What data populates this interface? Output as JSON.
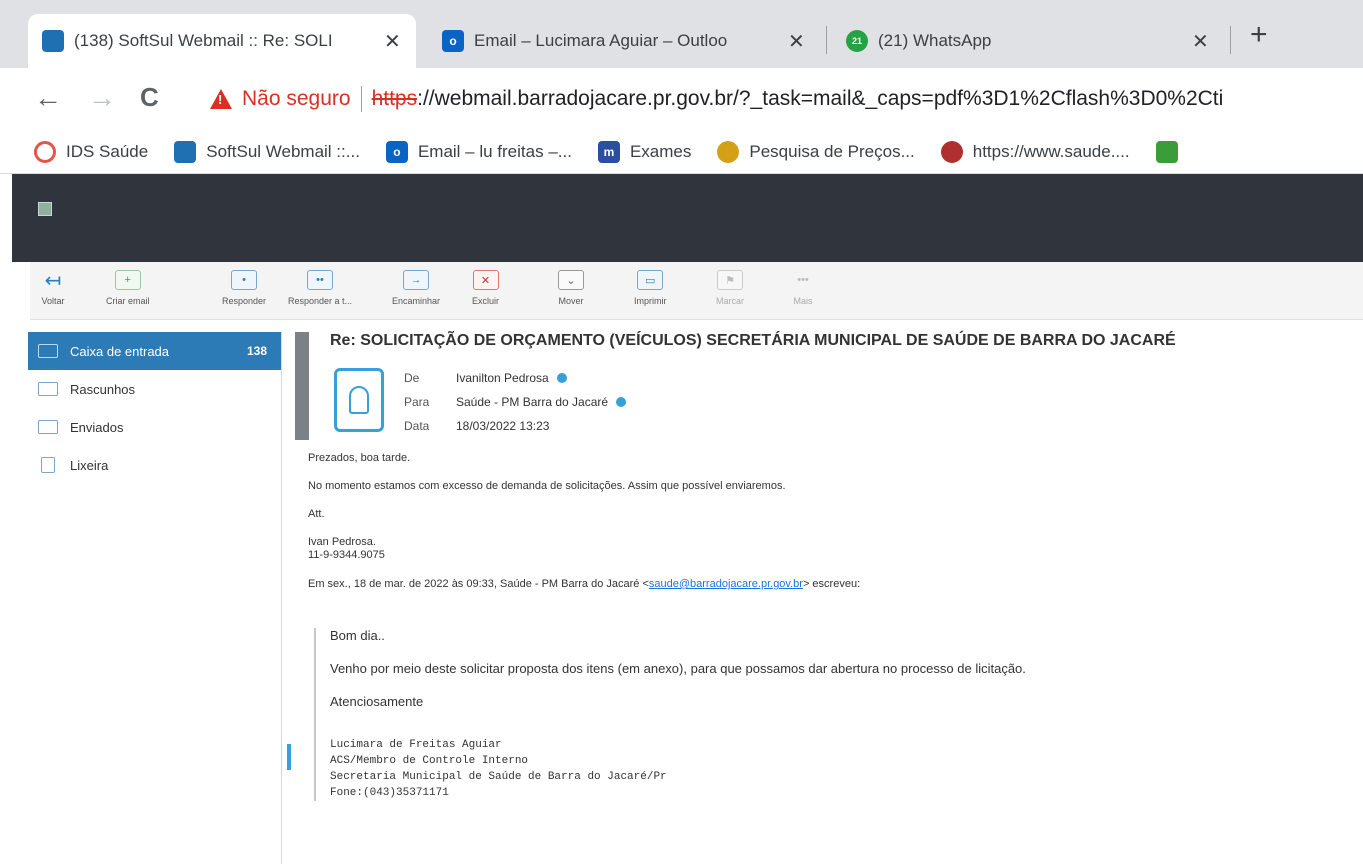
{
  "browser": {
    "tabs": [
      {
        "title": "(138) SoftSul Webmail :: Re: SOLI",
        "favicon": "webmail-favicon",
        "color": "#1f6fb3",
        "active": true
      },
      {
        "title": "Email – Lucimara Aguiar – Outloo",
        "favicon": "outlook-favicon",
        "color": "#0a64c4",
        "active": false
      },
      {
        "title": "(21) WhatsApp",
        "favicon": "whatsapp-favicon",
        "color": "#25a244",
        "badge": "21",
        "active": false
      }
    ],
    "close_glyph": "✕",
    "newtab_glyph": "+",
    "nav": {
      "back": "←",
      "forward": "→",
      "reload": "C"
    },
    "security_label": "Não seguro",
    "url_scheme": "https",
    "url_rest": "://webmail.barradojacare.pr.gov.br/?_task=mail&_caps=pdf%3D1%2Cflash%3D0%2Cti",
    "bookmarks": [
      {
        "label": "IDS Saúde",
        "icon": "ids-favicon",
        "color": "#e2574c"
      },
      {
        "label": "SoftSul Webmail ::...",
        "icon": "webmail-favicon",
        "color": "#1f6fb3"
      },
      {
        "label": "Email – lu freitas –...",
        "icon": "outlook-favicon",
        "color": "#0a64c4"
      },
      {
        "label": "Exames",
        "icon": "exames-favicon",
        "color": "#2a4fa0",
        "glyph": "m"
      },
      {
        "label": "Pesquisa de Preços...",
        "icon": "pesquisa-favicon",
        "color": "#d4a017"
      },
      {
        "label": "https://www.saude....",
        "icon": "saude-favicon",
        "color": "#b03030"
      }
    ]
  },
  "toolbar": {
    "voltar": "Voltar",
    "criar_email": "Criar email",
    "responder": "Responder",
    "responder_todos": "Responder a t...",
    "encaminhar": "Encaminhar",
    "excluir": "Excluir",
    "mover": "Mover",
    "imprimir": "Imprimir",
    "marcar": "Marcar",
    "mais": "Mais"
  },
  "folders": [
    {
      "label": "Caixa de entrada",
      "count": "138",
      "icon": "inbox-icon",
      "selected": true
    },
    {
      "label": "Rascunhos",
      "icon": "drafts-icon"
    },
    {
      "label": "Enviados",
      "icon": "sent-icon"
    },
    {
      "label": "Lixeira",
      "icon": "trash-icon"
    }
  ],
  "message": {
    "subject": "Re: SOLICITAÇÃO DE ORÇAMENTO (VEÍCULOS) SECRETÁRIA MUNICIPAL DE SAÚDE DE BARRA DO JACARÉ",
    "from_label": "De",
    "from": "Ivanilton Pedrosa",
    "to_label": "Para",
    "to": "Saúde - PM Barra do Jacaré",
    "date_label": "Data",
    "date": "18/03/2022 13:23",
    "body": {
      "greeting": "Prezados, boa tarde.",
      "line1": "No momento estamos com excesso de demanda de solicitações. Assim que possível enviaremos.",
      "closing": "Att.",
      "sig_name": "Ivan Pedrosa.",
      "sig_phone": "11-9-9344.9075",
      "quote_header_pre": "Em sex., 18 de mar. de 2022 às 09:33, Saúde - PM Barra do Jacaré <",
      "quote_email": "saude@barradojacare.pr.gov.br",
      "quote_header_post": "> escreveu:"
    },
    "quote": {
      "greeting": "Bom dia..",
      "line1": "Venho por meio deste solicitar proposta  dos itens (em anexo), para que possamos dar abertura no processo de licitação.",
      "closing": "Atenciosamente",
      "sig1": "Lucimara de Freitas Aguiar",
      "sig2": "ACS/Membro de Controle Interno",
      "sig3": "Secretaria Municipal de Saúde de Barra do Jacaré/Pr",
      "sig4": "Fone:(043)35371171"
    }
  }
}
